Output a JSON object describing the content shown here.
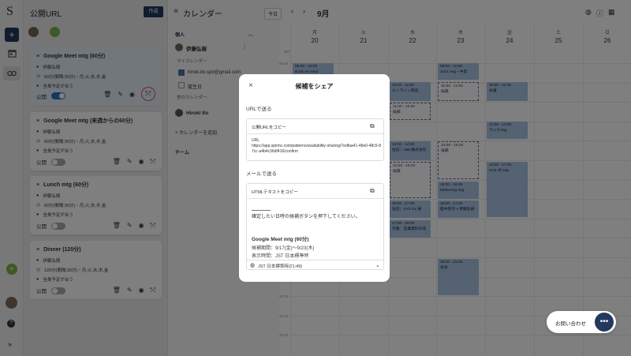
{
  "rail": {
    "logo": "S",
    "create_icon": "+",
    "avatar": "AI"
  },
  "url_panel": {
    "title": "公開URL",
    "create_button": "作成",
    "public_label": "公開",
    "cards": [
      {
        "title": "Google Meet mtg (60分)",
        "owner": "伊藤弘樹",
        "time": "60分(間隔:30分)・月,火,水,木,金",
        "attend": "全員予定が合う",
        "public": true
      },
      {
        "title": "Google Meet mtg (来週からの60分)",
        "owner": "伊藤弘樹",
        "time": "60分(間隔:30分)・月,火,水,木,金",
        "attend": "全員予定が合う",
        "public": false
      },
      {
        "title": "Lunch mtg (60分)",
        "owner": "伊藤弘樹",
        "time": "60分(間隔:30分)・月,火,水,木,金",
        "attend": "全員予定が合う",
        "public": false
      },
      {
        "title": "Dinner (120分)",
        "owner": "伊藤弘樹",
        "time": "120分(間隔:30分)・月,火,水,木,金",
        "attend": "全員予定が合う",
        "public": false
      }
    ]
  },
  "calendar_sidebar": {
    "collapse": "«",
    "title": "カレンダー",
    "personal": "個人",
    "user1": "伊藤弘樹",
    "my_calendars": "マイカレンダー",
    "cal_email": "hiroki.ito.spir@gmail.com",
    "birthday": "誕生日",
    "other_calendars": "他のカレンダー",
    "user2": "Hiroki Ito",
    "add_calendar": "+ カレンダーを追加",
    "team": "チーム"
  },
  "toolbar": {
    "today": "今日",
    "month": "9月"
  },
  "calendar": {
    "tz": "JST",
    "days": [
      {
        "dow": "月",
        "date": "20"
      },
      {
        "dow": "火",
        "date": "21"
      },
      {
        "dow": "水",
        "date": "22"
      },
      {
        "dow": "木",
        "date": "23"
      },
      {
        "dow": "金",
        "date": "24"
      },
      {
        "dow": "土",
        "date": "25"
      },
      {
        "dow": "日",
        "date": "26"
      }
    ],
    "hours": [
      "09:00",
      "10:00",
      "11:00",
      "12:00",
      "13:00",
      "14:00",
      "15:00",
      "16:00",
      "17:00",
      "18:00",
      "19:00",
      "20:00",
      "21:00",
      "22:00",
      "23:00"
    ],
    "events": {
      "e1": {
        "time": "09:00 - 10:00",
        "title": "Book on mind"
      },
      "e2": {
        "time": "09:00 - 10:00",
        "title": "1on1 mtg・中島"
      },
      "e3": {
        "time": "10:00 - 11:00",
        "title": "オンライン商談"
      },
      "e4": {
        "time": "10:00 - 11:00",
        "title": "候補"
      },
      "e5": {
        "time": "10:00 - 11:00",
        "title": "会議"
      },
      "e6": {
        "time": "11:00 - 12:00",
        "title": "候補"
      },
      "e7": {
        "time": "12:30 - 13:30",
        "title": "ランチmtg"
      },
      "e8": {
        "time": "13:00 - 14:00",
        "title": "往訪：ABC株式会社"
      },
      "e9": {
        "time": "13:00 - 15:00",
        "title": "候補"
      },
      "e10": {
        "time": "14:00 - 16:00",
        "title": "候補"
      },
      "e11": {
        "time": "14:00 - 17:00",
        "title": "Kick off mtg"
      },
      "e12": {
        "time": "15:00 - 16:00",
        "title": "Marketing mtg"
      },
      "e13": {
        "time": "16:00 - 17:00",
        "title": "往訪：XYZ inc 様"
      },
      "e14": {
        "time": "16:00 - 17:00",
        "title": "面中管作 x 伊藤弘樹"
      },
      "e15": {
        "time": "17:00 - 18:00",
        "title": "作業：営業資料作成"
      },
      "e16": {
        "time": "19:00 - 21:00",
        "title": "会食"
      }
    }
  },
  "modal": {
    "title": "候補をシェア",
    "url_section": "URLで送る",
    "copy_url": "公開URLをコピー",
    "url_label": "URL",
    "url_value": "https://app.spirinc.com/patterns/availability-sharing/7edfaa41-48e0-48c5-87cc-a4b4c36df416/confirm",
    "mail_section": "メールで送る",
    "copy_html": "HTMLテキストをコピー",
    "intro": "確定したい日時の候補ボタンを押下してください。",
    "event_title": "Google Meet mtg (60分)",
    "period": "候補期間：9/17(金)〜9/23(木)",
    "tz_line": "表示時間：JST 日本標準時",
    "tz_select": "JST 日本標準時(21:49)"
  },
  "chat": {
    "label": "お問い合わせ"
  }
}
